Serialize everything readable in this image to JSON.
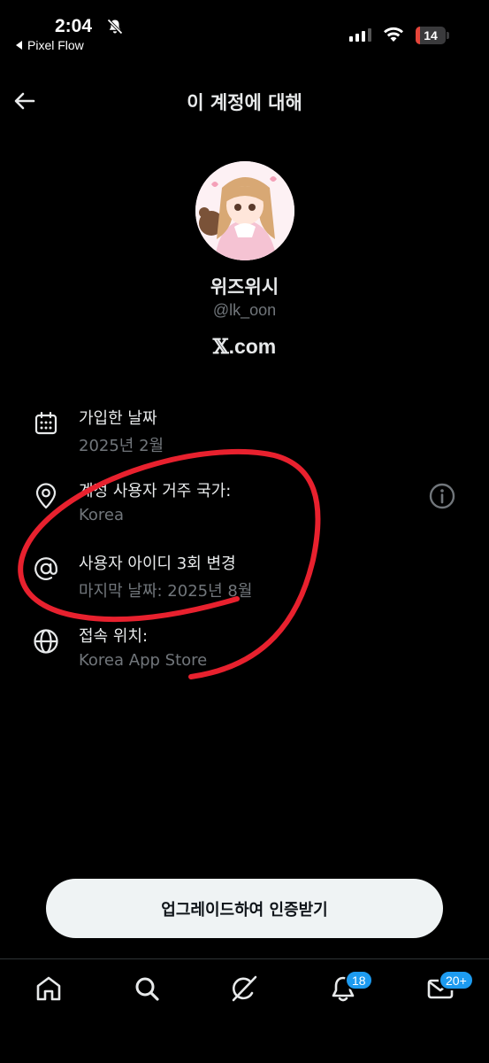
{
  "status_bar": {
    "time": "2:04",
    "back_app": "Pixel Flow",
    "battery_level": "14",
    "battery_fraction": 0.14
  },
  "header": {
    "title": "이 계정에 대해"
  },
  "profile": {
    "display_name": "위즈위시",
    "handle": "@lk_oon",
    "brand": ".com",
    "brand_mark": "𝕏"
  },
  "info": [
    {
      "icon": "calendar-icon",
      "title": "가입한 날짜",
      "value": "2025년 2월"
    },
    {
      "icon": "location-pin-icon",
      "title": "계정 사용자 거주 국가:",
      "value": "Korea"
    },
    {
      "icon": "at-sign-icon",
      "title": "사용자 아이디 3회 변경",
      "value": "마지막 날짜: 2025년 8월"
    },
    {
      "icon": "globe-icon",
      "title": "접속 위치:",
      "value": "Korea App Store"
    }
  ],
  "cta": {
    "label": "업그레이드하여 인증받기"
  },
  "tabs": {
    "items": [
      "home-icon",
      "search-icon",
      "grok-icon",
      "notifications-icon",
      "messages-icon"
    ],
    "notifications_badge": "18",
    "messages_badge": "20+"
  },
  "colors": {
    "background": "#000000",
    "primary_text": "#e7e9ea",
    "secondary_text": "#71767b",
    "accent": "#1d9bf0",
    "annotation": "#e8212e",
    "battery": "#e5453a"
  }
}
